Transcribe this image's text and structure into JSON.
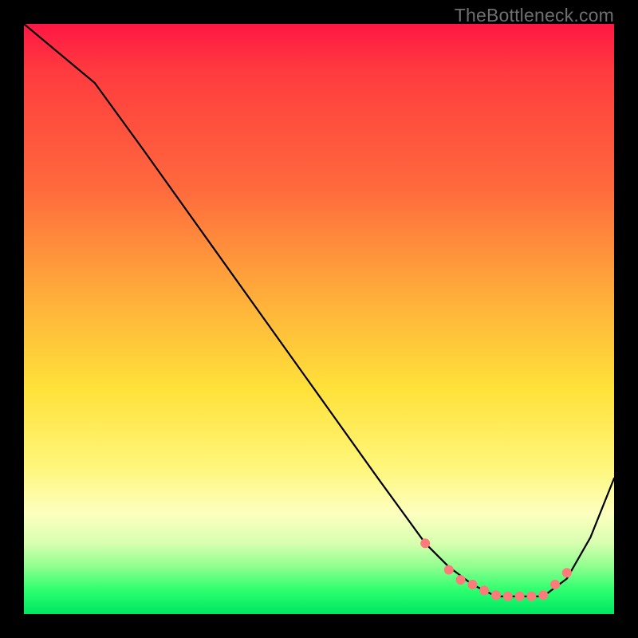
{
  "watermark": "TheBottleneck.com",
  "chart_data": {
    "type": "line",
    "title": "",
    "xlabel": "",
    "ylabel": "",
    "xlim": [
      0,
      100
    ],
    "ylim": [
      0,
      100
    ],
    "grid": false,
    "series": [
      {
        "name": "curve",
        "x": [
          0,
          6,
          12,
          20,
          30,
          40,
          50,
          60,
          68,
          72,
          76,
          80,
          84,
          88,
          92,
          96,
          100
        ],
        "y": [
          100,
          95,
          90,
          79,
          65,
          51,
          37,
          23,
          12,
          8,
          5,
          3,
          3,
          3,
          6,
          13,
          23
        ]
      }
    ],
    "markers": {
      "name": "dots",
      "x": [
        68,
        72,
        74,
        76,
        78,
        80,
        82,
        84,
        86,
        88,
        90,
        92
      ],
      "y": [
        12,
        7.5,
        5.8,
        5,
        4,
        3.2,
        3,
        3,
        3,
        3.2,
        5,
        7
      ]
    }
  }
}
